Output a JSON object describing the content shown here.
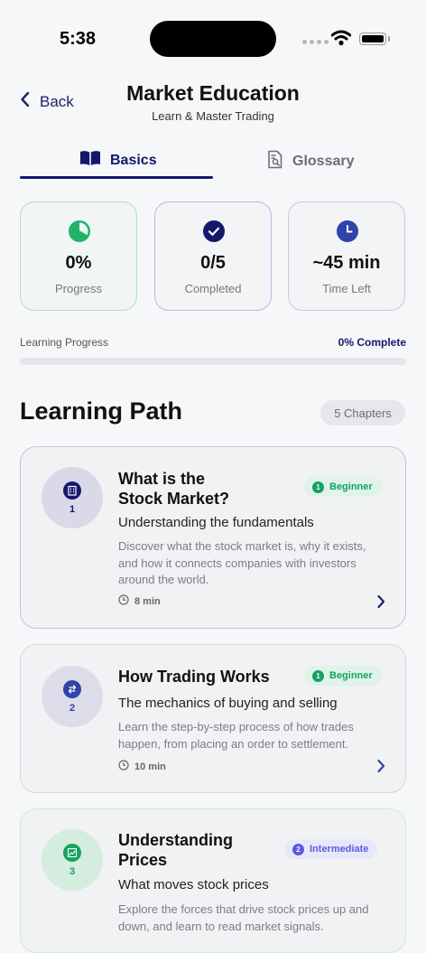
{
  "status_bar": {
    "time": "5:38"
  },
  "header": {
    "back_label": "Back",
    "title": "Market Education",
    "subtitle": "Learn & Master Trading"
  },
  "tabs": [
    {
      "label": "Basics",
      "active": true
    },
    {
      "label": "Glossary",
      "active": false
    }
  ],
  "stats": [
    {
      "value": "0%",
      "label": "Progress",
      "icon": "pie-chart-icon",
      "color": "#1fb36b"
    },
    {
      "value": "0/5",
      "label": "Completed",
      "icon": "checkmark-circle-icon",
      "color": "#14196b"
    },
    {
      "value": "~45 min",
      "label": "Time Left",
      "icon": "clock-icon",
      "color": "#2f43a8"
    }
  ],
  "progress": {
    "label": "Learning Progress",
    "value_text": "0% Complete",
    "fraction": 0
  },
  "learning_path": {
    "title": "Learning Path",
    "chapters_badge": "5 Chapters",
    "chapters": [
      {
        "number": "1",
        "title_line1": "What is the",
        "title_line2": "Stock Market?",
        "level": "Beginner",
        "subtitle": "Understanding the fundamentals",
        "description": "Discover what the stock market is, why it exists, and how it connects companies with investors around the world.",
        "duration": "8 min",
        "icon": "building-icon"
      },
      {
        "number": "2",
        "title_line1": "How Trading Works",
        "level": "Beginner",
        "subtitle": "The mechanics of buying and selling",
        "description": "Learn the step-by-step process of how trades happen, from placing an order to settlement.",
        "duration": "10 min",
        "icon": "swap-arrows-icon"
      },
      {
        "number": "3",
        "title_line1": "Understanding",
        "title_line2": "Prices",
        "level": "Intermediate",
        "subtitle": "What moves stock prices",
        "description": "Explore the forces that drive stock prices up and down, and learn to read market signals.",
        "icon": "chart-icon"
      }
    ]
  },
  "colors": {
    "accent": "#14196b",
    "beginner": "#12a264",
    "intermediate": "#5a59e0"
  }
}
